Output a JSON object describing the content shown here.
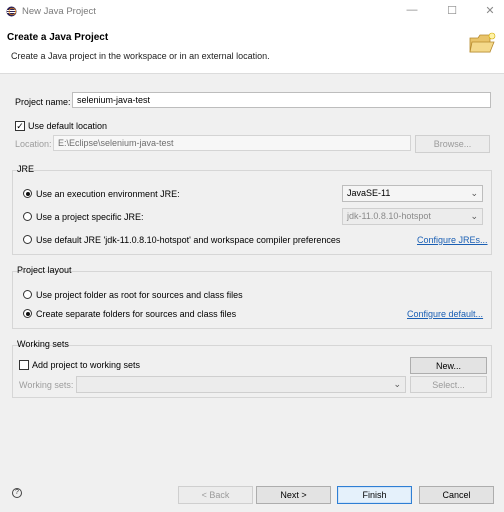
{
  "window": {
    "title": "New Java Project",
    "minimize_glyph": "—",
    "maximize_glyph": "☐",
    "close_glyph": "✕"
  },
  "header": {
    "heading": "Create a Java Project",
    "description": "Create a Java project in the workspace or in an external location."
  },
  "project_name": {
    "label": "Project name:",
    "value": "selenium-java-test"
  },
  "location": {
    "use_default_label": "Use default location",
    "use_default_checked": true,
    "label": "Location:",
    "value": "E:\\Eclipse\\selenium-java-test",
    "browse_label": "Browse..."
  },
  "jre": {
    "group_title": "JRE",
    "options": [
      {
        "label": "Use an execution environment JRE:",
        "selected": true,
        "combo": "JavaSE-11"
      },
      {
        "label": "Use a project specific JRE:",
        "selected": false,
        "combo": "jdk-11.0.8.10-hotspot"
      },
      {
        "label": "Use default JRE 'jdk-11.0.8.10-hotspot' and workspace compiler preferences",
        "selected": false
      }
    ],
    "configure_link": "Configure JREs..."
  },
  "project_layout": {
    "group_title": "Project layout",
    "options": [
      {
        "label": "Use project folder as root for sources and class files",
        "selected": false
      },
      {
        "label": "Create separate folders for sources and class files",
        "selected": true
      }
    ],
    "configure_link": "Configure default..."
  },
  "working_sets": {
    "group_title": "Working sets",
    "add_label": "Add project to working sets",
    "add_checked": false,
    "new_label": "New...",
    "sets_label": "Working sets:",
    "select_label": "Select..."
  },
  "footer": {
    "help_glyph": "?",
    "back_label": "< Back",
    "next_label": "Next >",
    "finish_label": "Finish",
    "cancel_label": "Cancel"
  }
}
